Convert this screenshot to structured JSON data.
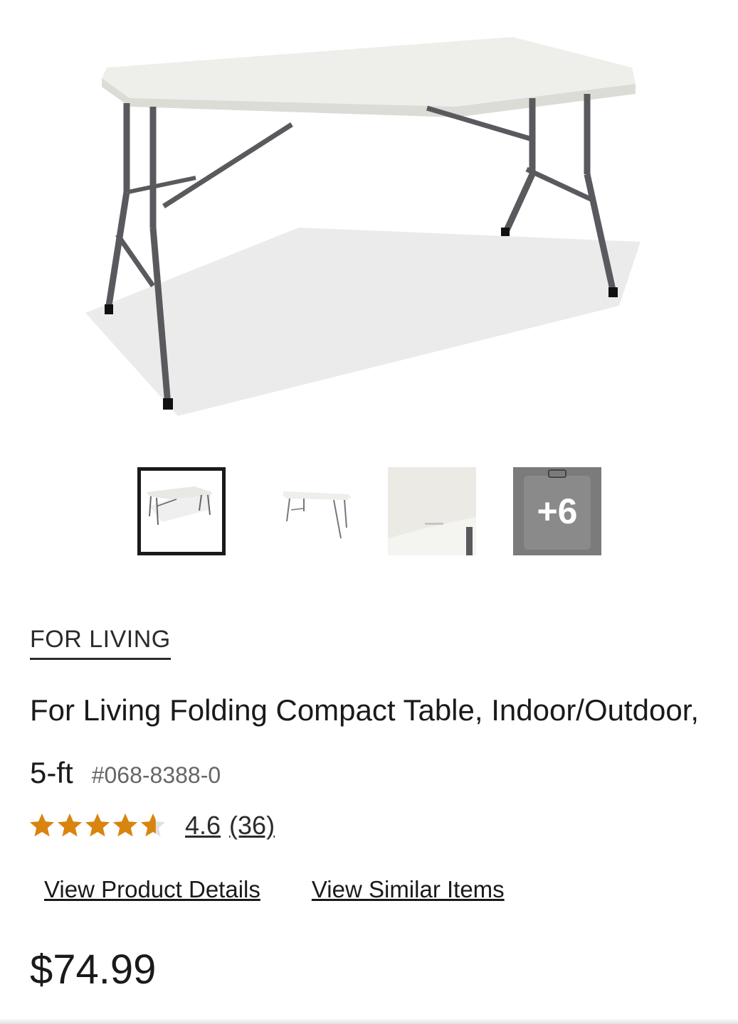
{
  "gallery": {
    "main_image_alt": "folding-table-image",
    "thumbnails": [
      {
        "name": "thumbnail-1",
        "selected": true
      },
      {
        "name": "thumbnail-2",
        "selected": false
      },
      {
        "name": "thumbnail-3",
        "selected": false
      },
      {
        "name": "thumbnail-more",
        "selected": false
      }
    ],
    "more_label": "+6"
  },
  "product": {
    "brand": "FOR LIVING",
    "title": "For Living Folding Compact Table, Indoor/Outdoor, 5-ft",
    "sku": "#068-8388-0",
    "rating": {
      "value": "4.6",
      "count": "(36)",
      "stars_value": 4.6,
      "stars_max": 5
    },
    "price": "$74.99"
  },
  "links": {
    "details": "View Product Details",
    "similar": "View Similar Items"
  },
  "colors": {
    "star": "#D9840F",
    "star_empty": "#E0E0E0",
    "text": "#1A1A1A"
  }
}
